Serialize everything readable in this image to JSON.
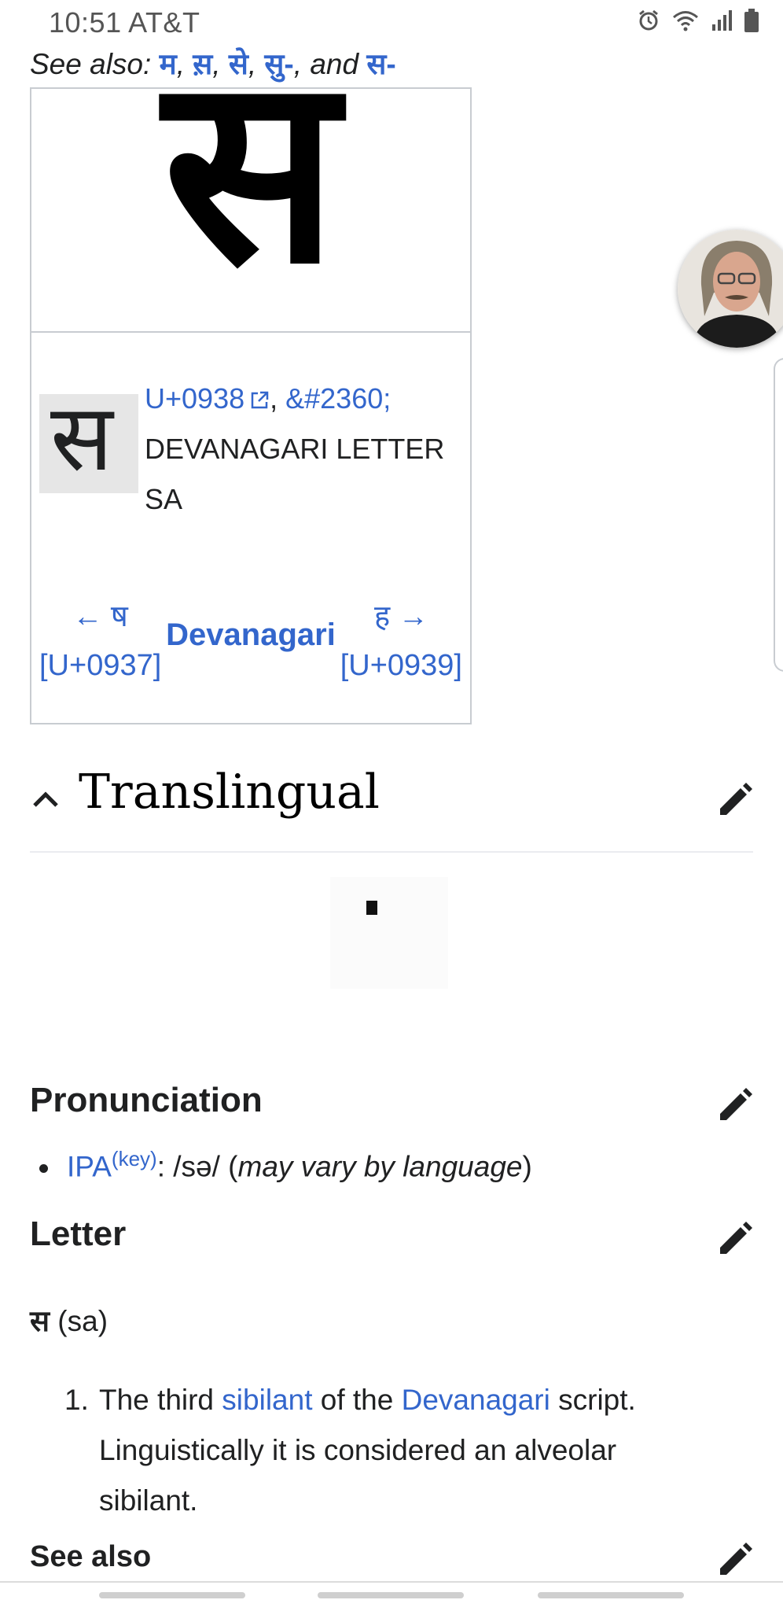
{
  "status_bar": {
    "time_carrier": "10:51 AT&T",
    "icons": [
      "alarm-icon",
      "wifi-icon",
      "signal-icon",
      "battery-icon"
    ]
  },
  "see_also_line": {
    "prefix": "See also: ",
    "links": [
      "म",
      "स़",
      "से",
      "सु-",
      "स-"
    ],
    "sep": ", ",
    "and": ", and "
  },
  "char_box": {
    "glyph": "स",
    "codepoint": "U+0938",
    "entity": "&#2360;",
    "name": "DEVANAGARI LETTER SA",
    "prev_glyph": "← ष",
    "prev_code": "[U+0937]",
    "script": "Devanagari",
    "next_glyph": "ह →",
    "next_code": "[U+0939]"
  },
  "translingual": {
    "title": "Translingual"
  },
  "pronunciation": {
    "title": "Pronunciation",
    "ipa_label": "IPA",
    "key_label": "(key)",
    "ipa_text": ": /sə/ (",
    "note": "may vary by language",
    "close": ")"
  },
  "letter": {
    "title": "Letter",
    "headword": "स",
    "translit": " (sa)",
    "def_number": "1.",
    "def_part1": "The third ",
    "def_link1": "sibilant",
    "def_part2": " of the ",
    "def_link2": "Devanagari",
    "def_part3": " script. Linguistically it is considered an alveolar sibilant."
  },
  "see_also_section": {
    "title": "See also"
  },
  "colors": {
    "link": "#3366cc",
    "text": "#202122",
    "border": "#c8ccd1"
  }
}
